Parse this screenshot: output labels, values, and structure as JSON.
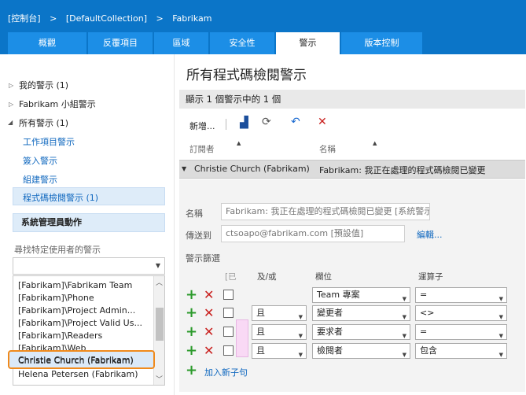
{
  "breadcrumb": [
    "[控制台]",
    ">",
    "[DefaultCollection]",
    ">",
    "Fabrikam"
  ],
  "tabs": [
    {
      "label": "概觀"
    },
    {
      "label": "反覆項目"
    },
    {
      "label": "區域"
    },
    {
      "label": "安全性"
    },
    {
      "label": "警示"
    },
    {
      "label": "版本控制"
    }
  ],
  "left": {
    "tree": [
      {
        "label": "我的警示 (1)"
      },
      {
        "label": "Fabrikam 小組警示"
      },
      {
        "label": "所有警示 (1)"
      }
    ],
    "subitems": [
      {
        "label": "工作項目警示"
      },
      {
        "label": "簽入警示"
      },
      {
        "label": "組建警示"
      },
      {
        "label": "程式碼檢閱警示 (1)"
      }
    ],
    "admin_header": "系統管理員動作",
    "find_label": "尋找特定使用者的警示",
    "user_list": [
      "[Fabrikam]\\Fabrikam Team",
      "[Fabrikam]\\Phone",
      "[Fabrikam]\\Project Admin...",
      "[Fabrikam]\\Project Valid Us...",
      "[Fabrikam]\\Readers",
      "[Fabrikam]\\Web",
      "Christie Church (Fabrikam)",
      "Helena Petersen (Fabrikam)"
    ]
  },
  "main": {
    "title": "所有程式碼檢閱警示",
    "count": "顯示 1 個警示中的 1 個",
    "new_label": "新增...",
    "grid": {
      "col_subscriber": "訂閱者",
      "col_name": "名稱",
      "row_subscriber": "Christie Church (Fabrikam)",
      "row_name": "Fabrikam: 我正在處理的程式碼檢閱已變更"
    },
    "form": {
      "name_label": "名稱",
      "name_value": "Fabrikam: 我正在處理的程式碼檢閱已變更 [系統警示]",
      "send_label": "傳送到",
      "send_value": "ctsoapo@fabrikam.com [預設值]",
      "edit_link": "編輯...",
      "filter_label": "警示篩選"
    },
    "filter_headers": {
      "group": "[已",
      "andor": "及/或",
      "field": "欄位",
      "operator": "運算子"
    },
    "rows": [
      {
        "andor": "",
        "field": "Team 專案",
        "operator": "="
      },
      {
        "andor": "且",
        "field": "變更者",
        "operator": "<>"
      },
      {
        "andor": "且",
        "field": "要求者",
        "operator": "="
      },
      {
        "andor": "且",
        "field": "檢閱者",
        "operator": "包含"
      }
    ],
    "add_clause": "加入新子句"
  },
  "colors": {
    "header": "#0b75c8",
    "tab": "#1c8ee6",
    "link": "#1068bf",
    "highlight": "#f08a1c"
  }
}
